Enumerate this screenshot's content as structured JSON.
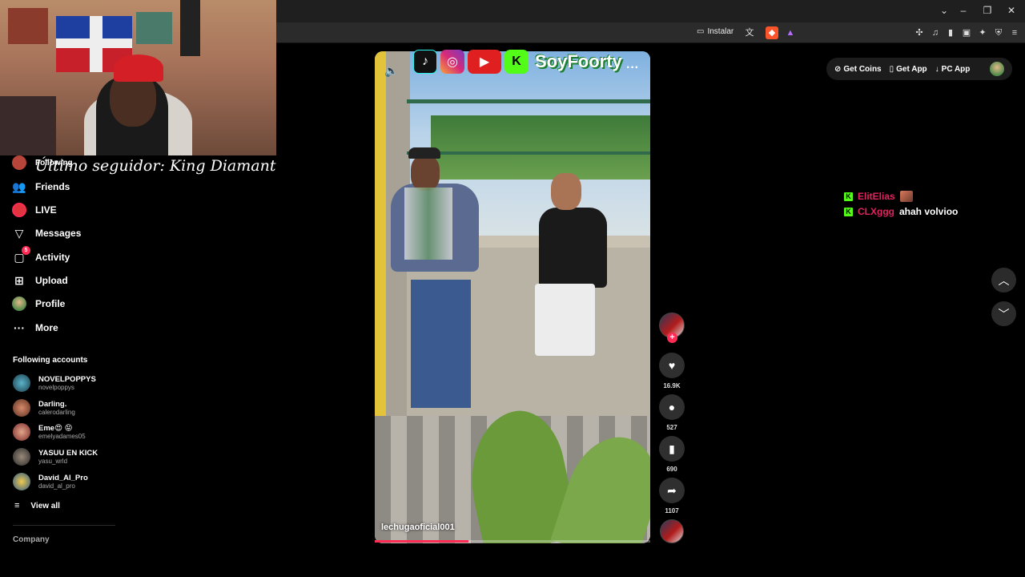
{
  "browser": {
    "address_url": "n",
    "install_label": "Instalar"
  },
  "overlay": {
    "caption": "Último seguidor: King  Diamant"
  },
  "sidebar": {
    "items": [
      {
        "label": "Following",
        "icon": "following-avatar-icon"
      },
      {
        "label": "Friends",
        "icon": "friends-icon"
      },
      {
        "label": "LIVE",
        "icon": "live-icon"
      },
      {
        "label": "Messages",
        "icon": "messages-icon"
      },
      {
        "label": "Activity",
        "icon": "activity-icon",
        "badge": "5"
      },
      {
        "label": "Upload",
        "icon": "upload-icon"
      },
      {
        "label": "Profile",
        "icon": "profile-avatar-icon"
      },
      {
        "label": "More",
        "icon": "more-icon"
      }
    ],
    "following_title": "Following accounts",
    "accounts": [
      {
        "name": "NOVELPOPPYS",
        "handle": "novelpoppys"
      },
      {
        "name": "Darling.",
        "handle": "calerodarling"
      },
      {
        "name": "Eme😍 😝",
        "handle": "emelyadames05"
      },
      {
        "name": "YASUU EN KICK",
        "handle": "yasu_wrld"
      },
      {
        "name": "David_Al_Pro",
        "handle": "david_al_pro"
      }
    ],
    "view_all": "View all",
    "company": "Company"
  },
  "video": {
    "brand_text": "SoyFoorty",
    "author": "lechugaoficial001",
    "progress": 0.34
  },
  "actions": {
    "likes": "16.9K",
    "comments": "527",
    "saves": "690",
    "shares": "1107"
  },
  "header": {
    "get_coins": "Get Coins",
    "get_app": "Get App",
    "pc_app": "PC App"
  },
  "chat": [
    {
      "user": "ElitElias",
      "message": ""
    },
    {
      "user": "CLXggg",
      "message": "ahah volvioo"
    }
  ],
  "colors": {
    "accent": "#fe2c55",
    "kick_green": "#53fc18"
  }
}
